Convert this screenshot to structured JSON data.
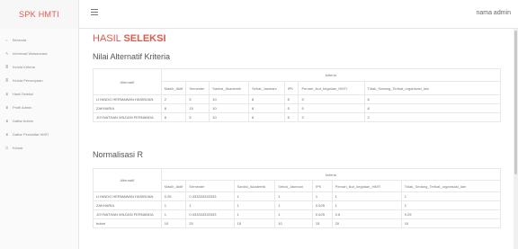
{
  "app": {
    "brand": "SPK HMTI",
    "user": "nama admin"
  },
  "sidebar": {
    "items": [
      {
        "icon": "home-icon",
        "glyph": "⌂",
        "label": "Beranda"
      },
      {
        "icon": "edit-icon",
        "glyph": "✎",
        "label": "Informasi Wawancara"
      },
      {
        "icon": "list-icon",
        "glyph": "≣",
        "label": "Kelola Kriteria"
      },
      {
        "icon": "list-icon",
        "glyph": "≣",
        "label": "Kelola Persenyaan"
      },
      {
        "icon": "trophy-icon",
        "glyph": "♛",
        "label": "Hasil Seleksi"
      },
      {
        "icon": "trophy-icon",
        "glyph": "♛",
        "label": "Profil Admin"
      },
      {
        "icon": "trophy-icon",
        "glyph": "♛",
        "label": "Daftar Admin"
      },
      {
        "icon": "trophy-icon",
        "glyph": "♛",
        "label": "Daftar Pendaftar HMTI"
      },
      {
        "icon": "power-icon",
        "glyph": "⏻",
        "label": "Keluar"
      }
    ]
  },
  "page": {
    "title_normal": "HASIL ",
    "title_bold": "SELEKSI"
  },
  "table1": {
    "title": "Nilai Alternatif Kriteria",
    "alt_header": "Alternatif",
    "group_header": "kriteria",
    "columns": [
      "Masih_Aktif",
      "Semester",
      "Sanksi_Akademik",
      "Sehat_Jasmani",
      "IPK",
      "Pernah_ikut_kegiatan_HMTI",
      "Tidak_Sedang_Terikat_organisasi_lain"
    ],
    "rows": [
      {
        "name": "LIYANDO HERMAWAN HASIBUAN",
        "cells": [
          "2",
          "5",
          "10",
          "8",
          "8",
          "5",
          "8"
        ]
      },
      {
        "name": "ZAKHARIA",
        "cells": [
          "8",
          "15",
          "10",
          "8",
          "5",
          "5",
          "8"
        ]
      },
      {
        "name": "JOYNATHAN WILDAN FERNANDA",
        "cells": [
          "8",
          "5",
          "10",
          "8",
          "5",
          "3",
          "2"
        ]
      }
    ]
  },
  "table2": {
    "title": "Normalisasi R",
    "alt_header": "Alternatif",
    "group_header": "kriteria",
    "columns": [
      "Masih_Aktif",
      "Semester",
      "Sanksi_Akademik",
      "Sehat_Jasmani",
      "IPK",
      "Pernah_ikut_kegiatan_HMTI",
      "Tidak_Sedang_Terikat_organisasi_lain"
    ],
    "rows": [
      {
        "name": "LIYANDO HERMAWAN HASIBUAN",
        "cells": [
          "0.25",
          "0.333333333333",
          "1",
          "1",
          "1",
          "1",
          "1"
        ]
      },
      {
        "name": "ZAKHARIA",
        "cells": [
          "1",
          "1",
          "1",
          "1",
          "0.625",
          "1",
          "1"
        ]
      },
      {
        "name": "JOYNATHAN WILDAN FERNANDA",
        "cells": [
          "1",
          "0.333333333333",
          "1",
          "1",
          "0.625",
          "0.6",
          "0.25"
        ]
      },
      {
        "name": "bobot",
        "cells": [
          "10",
          "20",
          "15",
          "10",
          "15",
          "20",
          "10"
        ]
      }
    ]
  }
}
